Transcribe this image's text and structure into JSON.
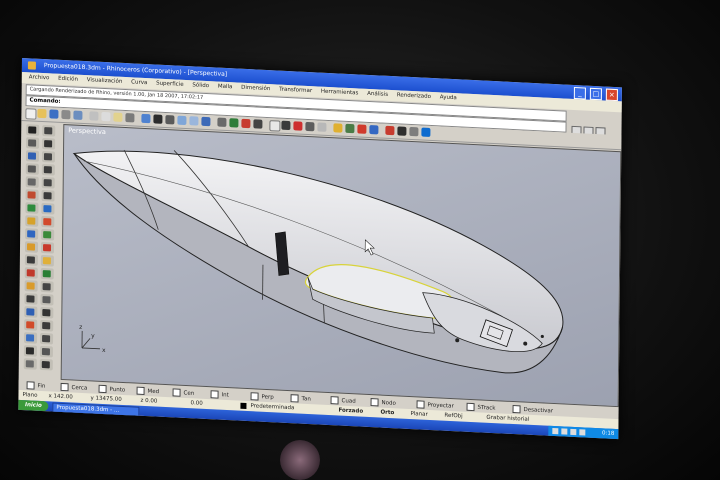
{
  "window": {
    "title": "Propuesta018.3dm - Rhinoceros (Corporativo) - [Perspectiva]",
    "buttons": [
      "_",
      "□",
      "×"
    ]
  },
  "menu": [
    "Archivo",
    "Edición",
    "Visualización",
    "Curva",
    "Superficie",
    "Sólido",
    "Malla",
    "Dimensión",
    "Transformar",
    "Herramientas",
    "Análisis",
    "Renderizado",
    "Ayuda"
  ],
  "history_line": "Cargando Renderizado de Rhino, versión 1.00, Jan 18 2007, 17:02:17",
  "command": {
    "label": "Comando:",
    "value": ""
  },
  "viewport": {
    "label": "Perspectiva"
  },
  "axis": {
    "x": "x",
    "y": "y",
    "z": "z"
  },
  "osnaps": [
    {
      "label": "Fin",
      "checked": false
    },
    {
      "label": "Cerca",
      "checked": false
    },
    {
      "label": "Punto",
      "checked": false
    },
    {
      "label": "Med",
      "checked": false
    },
    {
      "label": "Cen",
      "checked": false
    },
    {
      "label": "Int",
      "checked": false
    },
    {
      "label": "Perp",
      "checked": false
    },
    {
      "label": "Tan",
      "checked": false
    },
    {
      "label": "Cuad",
      "checked": false
    },
    {
      "label": "Nodo",
      "checked": false
    },
    {
      "label": "Proyectar",
      "checked": false
    },
    {
      "label": "STrack",
      "checked": false
    },
    {
      "label": "Desactivar",
      "checked": false
    }
  ],
  "status": {
    "plane": "Plano",
    "x": "x 142.00",
    "y": "y 13475.00",
    "z": "z 0.00",
    "extra": "0.00",
    "layer": "Predeterminada",
    "panes": [
      "Forzado",
      "Orto",
      "Planar",
      "RefObj",
      "Grabar historial"
    ]
  },
  "taskbar": {
    "start": "Inicio",
    "item": "Propuesta018.3dm - ...",
    "clock": "0:18"
  },
  "colors": {
    "titlebar": "#1c4fcf",
    "viewport": "#a9aebc",
    "hull": "#e8e8ea"
  }
}
